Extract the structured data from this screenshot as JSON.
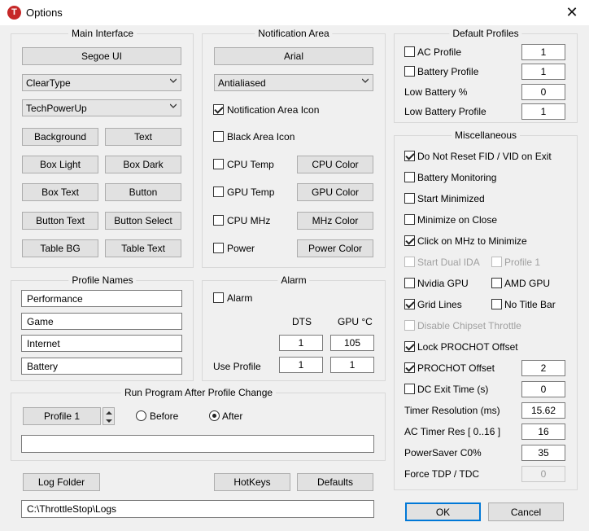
{
  "window": {
    "title": "Options",
    "app_icon_letter": "T",
    "close_glyph": "✕"
  },
  "main_interface": {
    "legend": "Main Interface",
    "font_button": "Segoe UI",
    "render_select": "ClearType",
    "skin_select": "TechPowerUp",
    "color_buttons": [
      "Background",
      "Text",
      "Box Light",
      "Box Dark",
      "Box Text",
      "Button",
      "Button Text",
      "Button Select",
      "Table BG",
      "Table Text"
    ]
  },
  "notification_area": {
    "legend": "Notification Area",
    "font_button": "Arial",
    "render_select": "Antialiased",
    "notification_icon": {
      "label": "Notification Area Icon",
      "checked": true
    },
    "black_area_icon": {
      "label": "Black Area Icon",
      "checked": false
    },
    "cpu_temp": {
      "label": "CPU Temp",
      "checked": false,
      "button": "CPU Color"
    },
    "gpu_temp": {
      "label": "GPU Temp",
      "checked": false,
      "button": "GPU Color"
    },
    "cpu_mhz": {
      "label": "CPU MHz",
      "checked": false,
      "button": "MHz Color"
    },
    "power": {
      "label": "Power",
      "checked": false,
      "button": "Power Color"
    }
  },
  "profile_names": {
    "legend": "Profile Names",
    "names": [
      "Performance",
      "Game",
      "Internet",
      "Battery"
    ]
  },
  "alarm": {
    "legend": "Alarm",
    "alarm_label": "Alarm",
    "alarm_checked": false,
    "dts_header": "DTS",
    "gpu_header": "GPU °C",
    "dts_value": "1",
    "gpu_value": "105",
    "use_profile_label": "Use Profile",
    "use_profile_dts": "1",
    "use_profile_gpu": "1"
  },
  "run_program": {
    "legend": "Run Program After Profile Change",
    "profile_button": "Profile 1",
    "before_label": "Before",
    "after_label": "After",
    "selected": "After",
    "program_path": ""
  },
  "bottom": {
    "log_folder": "Log Folder",
    "hotkeys": "HotKeys",
    "defaults": "Defaults",
    "log_path": "C:\\ThrottleStop\\Logs"
  },
  "default_profiles": {
    "legend": "Default Profiles",
    "ac_profile": {
      "label": "AC Profile",
      "checked": false,
      "value": "1"
    },
    "battery_profile": {
      "label": "Battery Profile",
      "checked": false,
      "value": "1"
    },
    "low_battery_pct": {
      "label": "Low Battery %",
      "value": "0"
    },
    "low_battery_profile": {
      "label": "Low Battery Profile",
      "value": "1"
    }
  },
  "misc": {
    "legend": "Miscellaneous",
    "do_not_reset": {
      "label": "Do Not Reset FID / VID on Exit",
      "checked": true
    },
    "battery_monitoring": {
      "label": "Battery Monitoring",
      "checked": false
    },
    "start_minimized": {
      "label": "Start Minimized",
      "checked": false
    },
    "minimize_on_close": {
      "label": "Minimize on Close",
      "checked": false
    },
    "click_mhz": {
      "label": "Click on MHz to Minimize",
      "checked": true
    },
    "start_dual_ida": {
      "label": "Start Dual IDA",
      "checked": false
    },
    "profile1": {
      "label": "Profile 1",
      "checked": false
    },
    "nvidia_gpu": {
      "label": "Nvidia GPU",
      "checked": false
    },
    "amd_gpu": {
      "label": "AMD GPU",
      "checked": false
    },
    "grid_lines": {
      "label": "Grid Lines",
      "checked": true
    },
    "no_title_bar": {
      "label": "No Title Bar",
      "checked": false
    },
    "disable_chipset": {
      "label": "Disable Chipset Throttle",
      "checked": false
    },
    "lock_prochot": {
      "label": "Lock PROCHOT Offset",
      "checked": true
    },
    "prochot_offset": {
      "label": "PROCHOT Offset",
      "checked": true,
      "value": "2"
    },
    "dc_exit_time": {
      "label": "DC Exit Time (s)",
      "checked": false,
      "value": "0"
    },
    "timer_resolution": {
      "label": "Timer Resolution (ms)",
      "value": "15.62"
    },
    "ac_timer_res": {
      "label": "AC Timer Res [ 0..16 ]",
      "value": "16"
    },
    "powersaver": {
      "label": "PowerSaver C0%",
      "value": "35"
    },
    "force_tdp": {
      "label": "Force TDP / TDC",
      "value": "0"
    }
  },
  "dialog": {
    "ok": "OK",
    "cancel": "Cancel"
  },
  "colors": {
    "accent": "#0078d7",
    "app_icon": "#c62828"
  }
}
